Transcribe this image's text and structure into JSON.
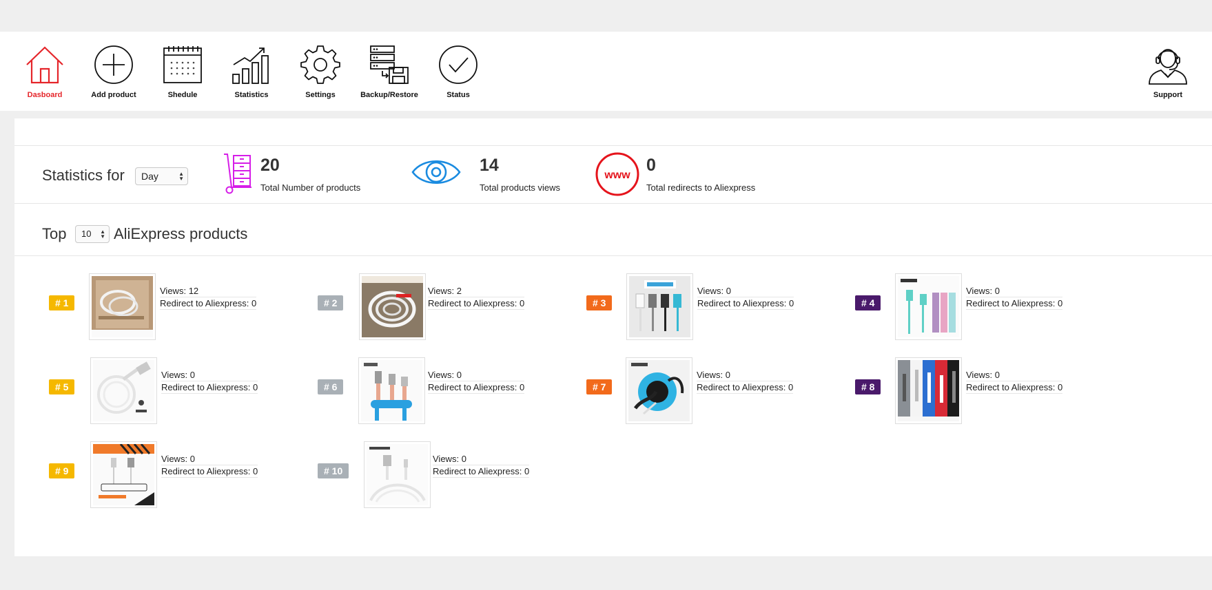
{
  "nav": {
    "items": [
      {
        "key": "dashboard",
        "label": "Dasboard",
        "icon": "home-icon",
        "active": true
      },
      {
        "key": "add",
        "label": "Add product",
        "icon": "plus-circle-icon"
      },
      {
        "key": "schedule",
        "label": "Shedule",
        "icon": "calendar-icon"
      },
      {
        "key": "statistics",
        "label": "Statistics",
        "icon": "bar-chart-icon"
      },
      {
        "key": "settings",
        "label": "Settings",
        "icon": "gear-icon"
      },
      {
        "key": "backup",
        "label": "Backup/Restore",
        "icon": "server-floppy-icon"
      },
      {
        "key": "status",
        "label": "Status",
        "icon": "check-circle-icon"
      }
    ],
    "support": {
      "label": "Support",
      "icon": "support-agent-icon"
    }
  },
  "stats": {
    "label": "Statistics for",
    "period": "Day",
    "cards": [
      {
        "value": "20",
        "caption": "Total Number of products",
        "icon": "hand-truck-icon",
        "color": "#d61ee8"
      },
      {
        "value": "14",
        "caption": "Total products views",
        "icon": "eye-icon",
        "color": "#1a8be0"
      },
      {
        "value": "0",
        "caption": "Total redirects to Aliexpress",
        "icon": "www-icon",
        "icon_text": "www",
        "color": "#e5141c"
      }
    ]
  },
  "top": {
    "prefix": "Top",
    "count": "10",
    "suffix": "AliExpress products"
  },
  "labels": {
    "views": "Views:",
    "redirect": "Redirect to Aliexpress:"
  },
  "products": [
    {
      "rank": "# 1",
      "color": "#f5b800",
      "views": "12",
      "redirects": "0"
    },
    {
      "rank": "# 2",
      "color": "#a9b0b6",
      "views": "2",
      "redirects": "0"
    },
    {
      "rank": "# 3",
      "color": "#f26a1b",
      "views": "0",
      "redirects": "0"
    },
    {
      "rank": "# 4",
      "color": "#4a1a6b",
      "views": "0",
      "redirects": "0"
    },
    {
      "rank": "# 5",
      "color": "#f5b800",
      "views": "0",
      "redirects": "0"
    },
    {
      "rank": "# 6",
      "color": "#a9b0b6",
      "views": "0",
      "redirects": "0"
    },
    {
      "rank": "# 7",
      "color": "#f26a1b",
      "views": "0",
      "redirects": "0"
    },
    {
      "rank": "# 8",
      "color": "#4a1a6b",
      "views": "0",
      "redirects": "0"
    },
    {
      "rank": "# 9",
      "color": "#f5b800",
      "views": "0",
      "redirects": "0"
    },
    {
      "rank": "# 10",
      "color": "#a9b0b6",
      "views": "0",
      "redirects": "0"
    }
  ]
}
